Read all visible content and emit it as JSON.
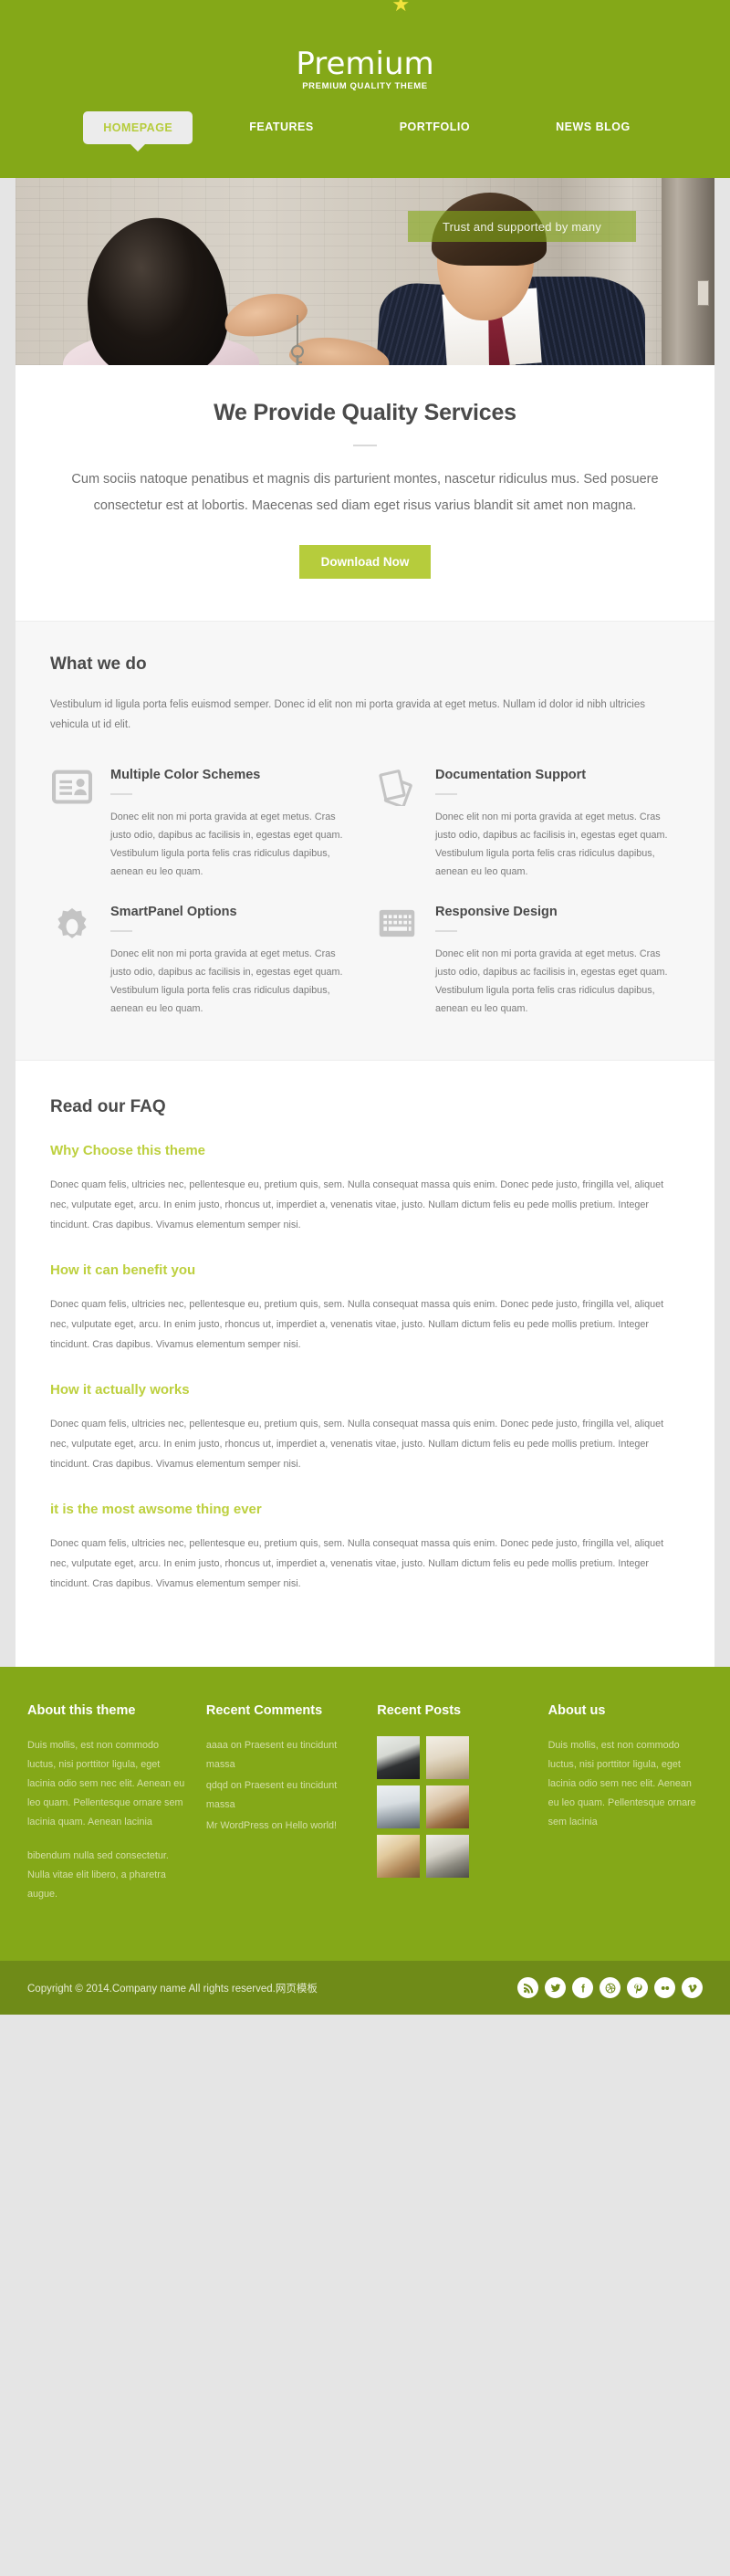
{
  "header": {
    "logo_word": "Premium",
    "logo_tagline": "PREMIUM QUALITY THEME",
    "star_icon": "star-icon",
    "nav": [
      {
        "label": "HOMEPAGE",
        "active": true
      },
      {
        "label": "FEATURES",
        "active": false
      },
      {
        "label": "PORTFOLIO",
        "active": false
      },
      {
        "label": "NEWS BLOG",
        "active": false
      }
    ]
  },
  "hero": {
    "caption": "Trust and supported by many",
    "image_alt": "businessman handing keys to smiling woman"
  },
  "intro": {
    "title": "We Provide Quality Services",
    "paragraph": "Cum sociis natoque penatibus et magnis dis parturient montes, nascetur ridiculus mus. Sed posuere consectetur est at lobortis. Maecenas sed diam eget risus varius blandit sit amet non magna.",
    "button_label": "Download Now"
  },
  "whatwedo": {
    "title": "What we do",
    "lead": "Vestibulum id ligula porta felis euismod semper. Donec id elit non mi porta gravida at eget metus. Nullam id dolor id nibh ultricies vehicula ut id elit.",
    "features": [
      {
        "icon": "id-card-icon",
        "title": "Multiple Color Schemes",
        "text": "Donec elit non mi porta gravida at eget metus. Cras justo odio, dapibus ac facilisis in, egestas eget quam. Vestibulum ligula porta felis cras ridiculus dapibus, aenean eu leo quam."
      },
      {
        "icon": "documents-icon",
        "title": "Documentation Support",
        "text": "Donec elit non mi porta gravida at eget metus. Cras justo odio, dapibus ac facilisis in, egestas eget quam. Vestibulum ligula porta felis cras ridiculus dapibus, aenean eu leo quam."
      },
      {
        "icon": "gear-icon",
        "title": "SmartPanel Options",
        "text": "Donec elit non mi porta gravida at eget metus. Cras justo odio, dapibus ac facilisis in, egestas eget quam. Vestibulum ligula porta felis cras ridiculus dapibus, aenean eu leo quam."
      },
      {
        "icon": "keyboard-icon",
        "title": "Responsive Design",
        "text": "Donec elit non mi porta gravida at eget metus. Cras justo odio, dapibus ac facilisis in, egestas eget quam. Vestibulum ligula porta felis cras ridiculus dapibus, aenean eu leo quam."
      }
    ]
  },
  "faq": {
    "title": "Read our FAQ",
    "body": "Donec quam felis, ultricies nec, pellentesque eu, pretium quis, sem. Nulla consequat massa quis enim. Donec pede justo, fringilla vel, aliquet nec, vulputate eget, arcu. In enim justo, rhoncus ut, imperdiet a, venenatis vitae, justo. Nullam dictum felis eu pede mollis pretium. Integer tincidunt. Cras dapibus. Vivamus elementum semper nisi.",
    "items": [
      {
        "question": "Why Choose this theme"
      },
      {
        "question": "How it can benefit you"
      },
      {
        "question": "How it actually works"
      },
      {
        "question": "it is the most awsome thing ever"
      }
    ]
  },
  "footer": {
    "about_theme": {
      "title": "About this theme",
      "p1": "Duis mollis, est non commodo luctus, nisi porttitor ligula, eget lacinia odio sem nec elit. Aenean eu leo quam. Pellentesque ornare sem lacinia quam. Aenean lacinia",
      "p2": "bibendum nulla sed consectetur. Nulla vitae elit libero, a pharetra augue."
    },
    "recent_comments": {
      "title": "Recent Comments",
      "items": [
        "aaaa on Praesent eu tincidunt massa",
        "qdqd on Praesent eu tincidunt massa",
        "Mr WordPress on Hello world!"
      ]
    },
    "recent_posts": {
      "title": "Recent Posts",
      "thumbnails": [
        "post-thumbnail-1",
        "post-thumbnail-2",
        "post-thumbnail-3",
        "post-thumbnail-4",
        "post-thumbnail-5",
        "post-thumbnail-6"
      ]
    },
    "about_us": {
      "title": "About us",
      "p1": "Duis mollis, est non commodo luctus, nisi porttitor ligula, eget lacinia odio sem nec elit. Aenean eu leo quam. Pellentesque ornare sem lacinia"
    }
  },
  "copyright": {
    "text": "Copyright © 2014.Company name All rights reserved.网页模板",
    "socials": [
      "rss-icon",
      "twitter-icon",
      "facebook-icon",
      "dribbble-icon",
      "pinterest-icon",
      "flickr-icon",
      "vimeo-icon"
    ]
  },
  "colors": {
    "brand_green": "#84a818",
    "accent_lime": "#b6cc3c",
    "footer_dark_green": "#6f8b18",
    "page_bg": "#e5e5e5",
    "text_dark": "#4a4a4a",
    "text_muted": "#7b7b7b"
  }
}
